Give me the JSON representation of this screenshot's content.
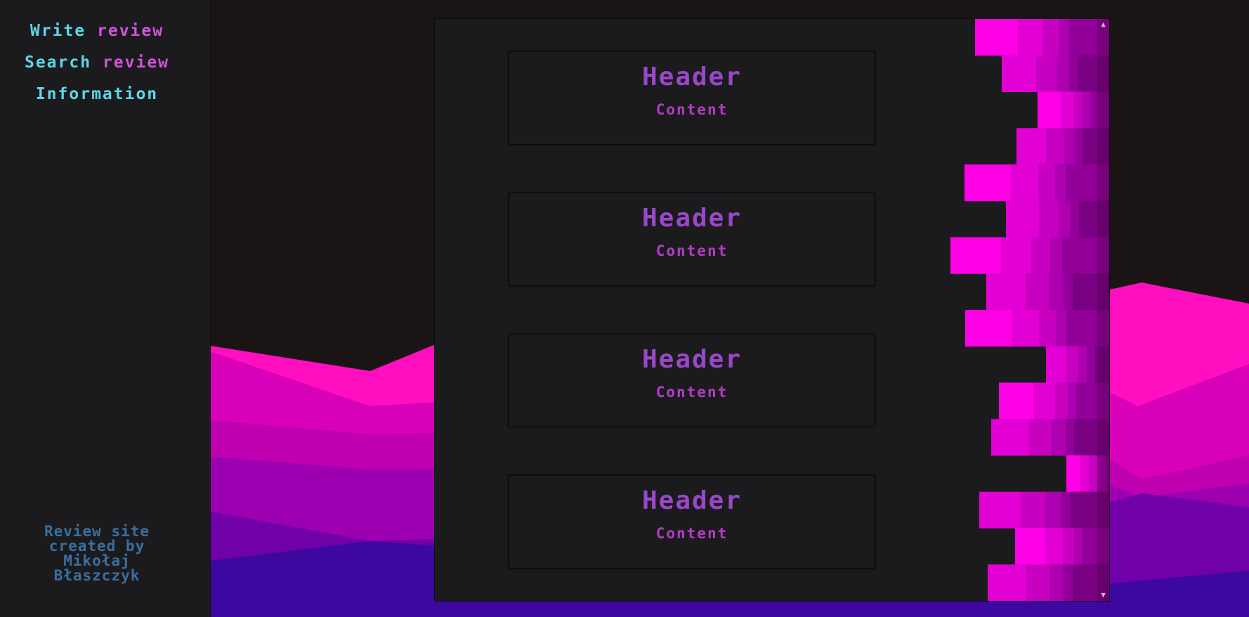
{
  "nav": {
    "write_review": [
      "Write",
      " review"
    ],
    "search_review": [
      "Search",
      " review"
    ],
    "information": "Information"
  },
  "footer": {
    "credit_lines": [
      "Review site",
      "created by",
      "Mikołaj",
      "Błaszczyk"
    ]
  },
  "cards": [
    {
      "header": "Header",
      "content": "Content"
    },
    {
      "header": "Header",
      "content": "Content"
    },
    {
      "header": "Header",
      "content": "Content"
    },
    {
      "header": "Header",
      "content": "Content"
    }
  ],
  "scrollbar": {
    "up_icon": "▲",
    "down_icon": "▼"
  },
  "colors": {
    "nav_cyan": "#5fd6e8",
    "nav_pink": "#d254d8",
    "card_header": "#9a47c8",
    "card_content": "#b23cc4",
    "credit": "#3a6fa0",
    "magenta": "#ff0fe0",
    "violet": "#3d08a0"
  }
}
